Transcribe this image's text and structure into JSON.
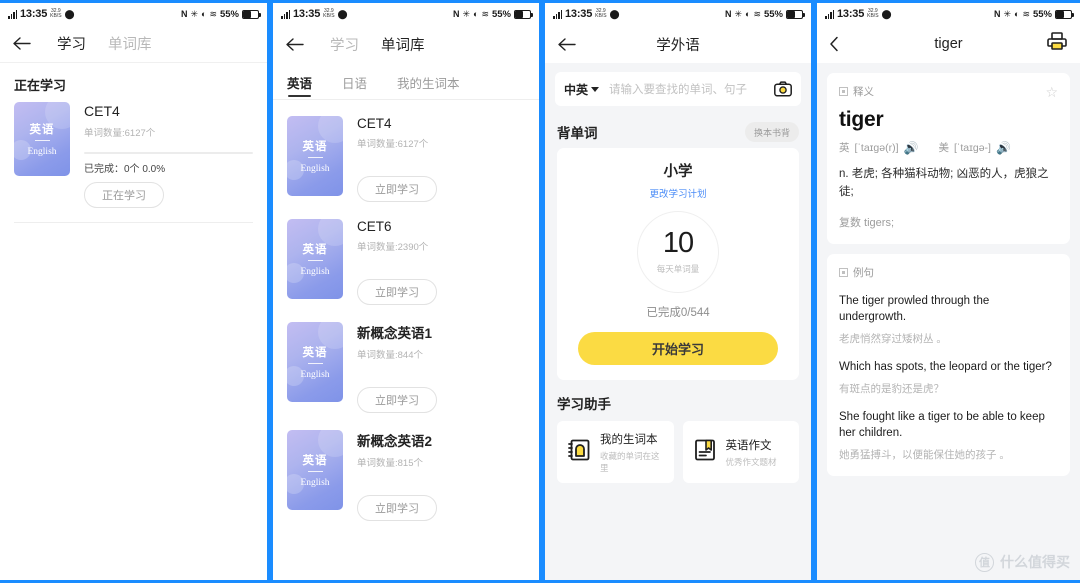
{
  "statusbar": {
    "time": "13:35",
    "netspeed_top": "32.9",
    "netspeed_bottom": "KB/S",
    "nfc": "N",
    "bluetooth": "bluetooth-icon",
    "dnd": "dnd-icon",
    "wifi": "wifi-icon",
    "battery_pct": "55%"
  },
  "panel1": {
    "nav": {
      "back": "back-arrow",
      "tab_study": "学习",
      "tab_wordbank": "单词库"
    },
    "section_title": "正在学习",
    "book": {
      "cover_cn": "英语",
      "cover_en": "English",
      "name": "CET4",
      "count": "单词数量:6127个",
      "done": "已完成：0个 0.0%",
      "progress_pct": 0,
      "button": "正在学习"
    }
  },
  "panel2": {
    "nav": {
      "back": "back-arrow",
      "tab_study": "学习",
      "tab_wordbank": "单词库"
    },
    "tabs": [
      {
        "label": "英语",
        "active": true
      },
      {
        "label": "日语",
        "active": false
      },
      {
        "label": "我的生词本",
        "active": false
      }
    ],
    "books": [
      {
        "cover_cn": "英语",
        "cover_en": "English",
        "name": "CET4",
        "bold": false,
        "count": "单词数量:6127个",
        "button": "立即学习"
      },
      {
        "cover_cn": "英语",
        "cover_en": "English",
        "name": "CET6",
        "bold": false,
        "count": "单词数量:2390个",
        "button": "立即学习"
      },
      {
        "cover_cn": "英语",
        "cover_en": "English",
        "name": "新概念英语1",
        "bold": true,
        "count": "单词数量:844个",
        "button": "立即学习"
      },
      {
        "cover_cn": "英语",
        "cover_en": "English",
        "name": "新概念英语2",
        "bold": true,
        "count": "单词数量:815个",
        "button": "立即学习"
      }
    ]
  },
  "panel3": {
    "nav": {
      "back": "back-arrow",
      "title": "学外语"
    },
    "search": {
      "lang": "中英",
      "placeholder": "请输入要查找的单词、句子",
      "camera": "camera-icon"
    },
    "recite": {
      "section_title": "背单词",
      "change_book": "换本书背",
      "plan_title": "小学",
      "plan_link": "更改学习计划",
      "daily_count": "10",
      "daily_label": "每天单词量",
      "progress": "已完成0/544",
      "start_button": "开始学习"
    },
    "assistant": {
      "section_title": "学习助手",
      "items": [
        {
          "icon": "notebook-icon",
          "title": "我的生词本",
          "subtitle": "收藏的单词在这里"
        },
        {
          "icon": "book-icon",
          "title": "英语作文",
          "subtitle": "优秀作文题材"
        }
      ]
    }
  },
  "panel4": {
    "nav": {
      "back": "back-chevron",
      "title": "tiger",
      "print": "printer-icon"
    },
    "definition": {
      "tag": "释义",
      "star": "star-outline-icon",
      "word": "tiger",
      "uk_label": "英",
      "uk_phonetic": "[ˈtaɪɡə(r)]",
      "us_label": "美",
      "us_phonetic": "[ˈtaɪɡə-]",
      "speaker": "speaker-icon",
      "meaning": "n. 老虎; 各种猫科动物; 凶恶的人，虎狼之徒;",
      "plural": "复数 tigers;"
    },
    "examples": {
      "tag": "例句",
      "items": [
        {
          "en": "The tiger prowled through the undergrowth.",
          "cn": "老虎悄然穿过矮树丛 。"
        },
        {
          "en": "Which has spots, the leopard or the tiger?",
          "cn": "有斑点的是豹还是虎？"
        },
        {
          "en": "She fought like a tiger to be able to keep her children.",
          "cn": "她勇猛搏斗，以便能保住她的孩子 。"
        }
      ]
    }
  },
  "watermark": {
    "logo": "值",
    "text": "什么值得买"
  },
  "colors": {
    "accent_blue": "#1a8cff",
    "yellow": "#fbdb43",
    "card_purple": "#8b9bea",
    "link_blue": "#4a8cf7",
    "speaker_red": "#f04b4b"
  }
}
